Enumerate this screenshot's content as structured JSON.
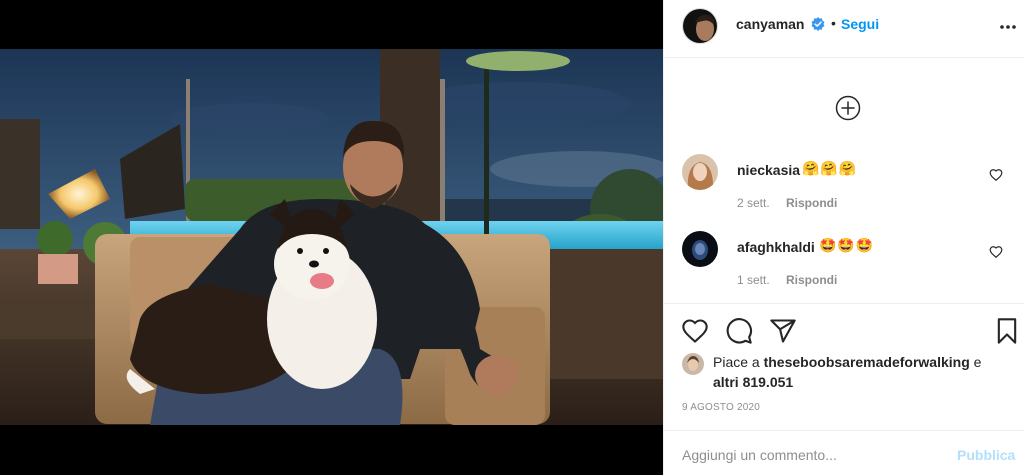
{
  "post": {
    "author": "canyaman",
    "follow_label": "Segui",
    "separator": "•",
    "image_icon": "photo-man-with-dog"
  },
  "comments": [
    {
      "user": "nieckasia",
      "emoji": "🤗🤗🤗",
      "time": "2 sett.",
      "reply_label": "Rispondi"
    },
    {
      "user": "afaghkhaldi",
      "emoji": "🤩🤩🤩",
      "time": "1 sett.",
      "reply_label": "Rispondi"
    }
  ],
  "likes": {
    "prefix": "Piace a ",
    "user": "theseboobsaremadeforwalking",
    "middle": " e",
    "others": "altri 819.051"
  },
  "date": "9 AGOSTO 2020",
  "add_comment": {
    "placeholder": "Aggiungi un commento...",
    "post_label": "Pubblica"
  },
  "colors": {
    "accent": "#0095f6",
    "verified": "#3897f0",
    "muted": "#8e8e8e",
    "post_disabled": "#b2dffc"
  }
}
